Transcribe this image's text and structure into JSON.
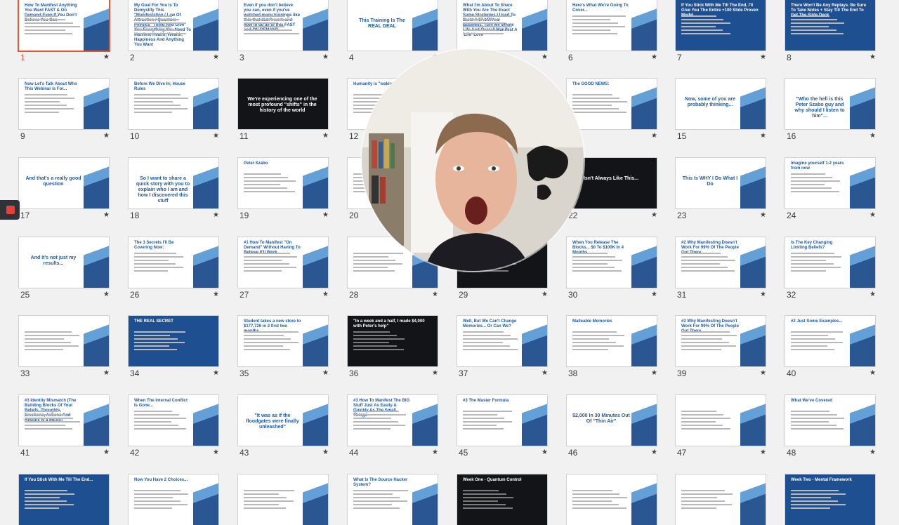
{
  "slides": [
    {
      "n": "1",
      "title": "How To Manifest Anything You Want FAST & On Demand Even If You Don't Believe You Can",
      "style": "light",
      "selected": true
    },
    {
      "n": "2",
      "title": "My Goal For You Is To Demystify This \"Manifestation / Law Of Attraction / Quantum Physics\" Thing And Give You Everything You Need To Manifest Health, Wealth, Happiness And Anything You Want",
      "style": "light"
    },
    {
      "n": "3",
      "title": "Even if you don't believe you can, even if you've watched many trainings like this that didn't work and how to do all of this FAST and ON DEMAND",
      "style": "light"
    },
    {
      "n": "4",
      "title": "This Training Is The REAL DEAL",
      "style": "light",
      "center": true
    },
    {
      "n": "5",
      "title": "What I'm About To Share With You Are The Exact Same Strategies I Used To Build A $7.1M/Year Business, Turn My Whole Life And Overall Manifest A 'Life' Love",
      "style": "light"
    },
    {
      "n": "6",
      "title": "Here's What We're Going To Cover...",
      "style": "light"
    },
    {
      "n": "7",
      "title": "If You Stick With Me Till The End, I'll Give You The Entire +100 Slide Proven Model...",
      "style": "blue"
    },
    {
      "n": "8",
      "title": "There Won't Be Any Replays. Be Sure To Take Notes + Stay Till The End To Get The Slide Deck",
      "style": "blue"
    },
    {
      "n": "9",
      "title": "Now Let's Talk About Who This Webinar Is For...",
      "style": "light"
    },
    {
      "n": "10",
      "title": "Before We Dive In; House Rules",
      "style": "light"
    },
    {
      "n": "11",
      "title": "We're experiencing one of the most profound \"shifts\" in the history of the world",
      "style": "dark",
      "center": true
    },
    {
      "n": "12",
      "title": "Humanity is \"waking",
      "style": "light"
    },
    {
      "n": "13",
      "title": "",
      "style": "light"
    },
    {
      "n": "14",
      "title": "The GOOD NEWS:",
      "style": "light"
    },
    {
      "n": "15",
      "title": "Now, some of you are probably thinking...",
      "style": "light",
      "center": true
    },
    {
      "n": "16",
      "title": "\"Who the hell is this Peter Szabo guy and why should I listen to him\"...",
      "style": "light",
      "center": true
    },
    {
      "n": "17",
      "title": "And that's a really good question",
      "style": "light",
      "center": true
    },
    {
      "n": "18",
      "title": "So I want to share a quick story with you to explain who I am and how I discovered this stuff",
      "style": "light",
      "center": true
    },
    {
      "n": "19",
      "title": "Peter Szabo",
      "style": "light"
    },
    {
      "n": "20",
      "title": "",
      "style": "light"
    },
    {
      "n": "21",
      "title": "",
      "style": "light"
    },
    {
      "n": "22",
      "title": "Isn't Always Like This...",
      "style": "dark",
      "center": true
    },
    {
      "n": "23",
      "title": "This Is WHY I Do What I Do",
      "style": "light",
      "center": true
    },
    {
      "n": "24",
      "title": "Imagine yourself 1-2 years from now",
      "style": "light"
    },
    {
      "n": "25",
      "title": "And it's not just my results...",
      "style": "light",
      "center": true
    },
    {
      "n": "26",
      "title": "The 3 Secrets I'll Be Covering Now:",
      "style": "light"
    },
    {
      "n": "27",
      "title": "#1 How To Manifest \"On Demand\" Without Having To Believe It'll Work",
      "style": "light"
    },
    {
      "n": "28",
      "title": "",
      "style": "light"
    },
    {
      "n": "29",
      "title": "",
      "style": "dark"
    },
    {
      "n": "30",
      "title": "When You Release The Blocks... $0 To $100K In 4 Months",
      "style": "light"
    },
    {
      "n": "31",
      "title": "#2 Why Manifesting Doesn't Work For 99% Of The People Out There",
      "style": "light"
    },
    {
      "n": "32",
      "title": "Is The Key Changing Limiting Beliefs?",
      "style": "light"
    },
    {
      "n": "33",
      "title": "",
      "style": "light"
    },
    {
      "n": "34",
      "title": "THE REAL SECRET",
      "style": "blue"
    },
    {
      "n": "35",
      "title": "Student takes a new store to $177,726 in 2 first two months",
      "style": "light"
    },
    {
      "n": "36",
      "title": "\"In a week and a half, I made $4,000 with Peter's help\"",
      "style": "dark"
    },
    {
      "n": "37",
      "title": "Well, But We Can't Change Memories... Or Can We?",
      "style": "light"
    },
    {
      "n": "38",
      "title": "Malleable Memories",
      "style": "light"
    },
    {
      "n": "39",
      "title": "#2 Why Manifesting Doesn't Work For 99% Of The People Out There",
      "style": "light"
    },
    {
      "n": "40",
      "title": "#2 Just Some Examples...",
      "style": "light"
    },
    {
      "n": "41",
      "title": "#3 Identity Mismatch (The Building Blocks Of Your Beliefs, Thoughts, Emotions, Actions And Results Is a MESS)",
      "style": "light"
    },
    {
      "n": "42",
      "title": "When The Internal Conflict Is Gone...",
      "style": "light"
    },
    {
      "n": "43",
      "title": "\"It was as if the floodgates were finally unleashed\"",
      "style": "light",
      "center": true
    },
    {
      "n": "44",
      "title": "#3 How To Manifest The BIG Stuff Just As Easily & Quickly As The Small Things",
      "style": "light"
    },
    {
      "n": "45",
      "title": "#3 The Master Formula",
      "style": "light"
    },
    {
      "n": "46",
      "title": "$2,000 In 30 Minutes Out Of \"Thin Air\"",
      "style": "light",
      "center": true
    },
    {
      "n": "47",
      "title": "",
      "style": "light"
    },
    {
      "n": "48",
      "title": "What We've Covered",
      "style": "light"
    },
    {
      "n": "49",
      "title": "If You Stick With Me Till The End...",
      "style": "blue"
    },
    {
      "n": "50",
      "title": "Now You Have 2 Choices...",
      "style": "light"
    },
    {
      "n": "51",
      "title": "",
      "style": "light"
    },
    {
      "n": "52",
      "title": "What Is The Source Hacker System?",
      "style": "light"
    },
    {
      "n": "53",
      "title": "Week One - Quantum Control",
      "style": "dark"
    },
    {
      "n": "54",
      "title": "",
      "style": "light"
    },
    {
      "n": "55",
      "title": "",
      "style": "light"
    },
    {
      "n": "56",
      "title": "Week Two - Mental Framework",
      "style": "blue"
    }
  ],
  "star_glyph": "★",
  "webcam": {
    "label": "presenter-webcam"
  },
  "colors": {
    "accent": "#1d5aa5",
    "selected": "#e4572e",
    "record": "#e5413b"
  }
}
